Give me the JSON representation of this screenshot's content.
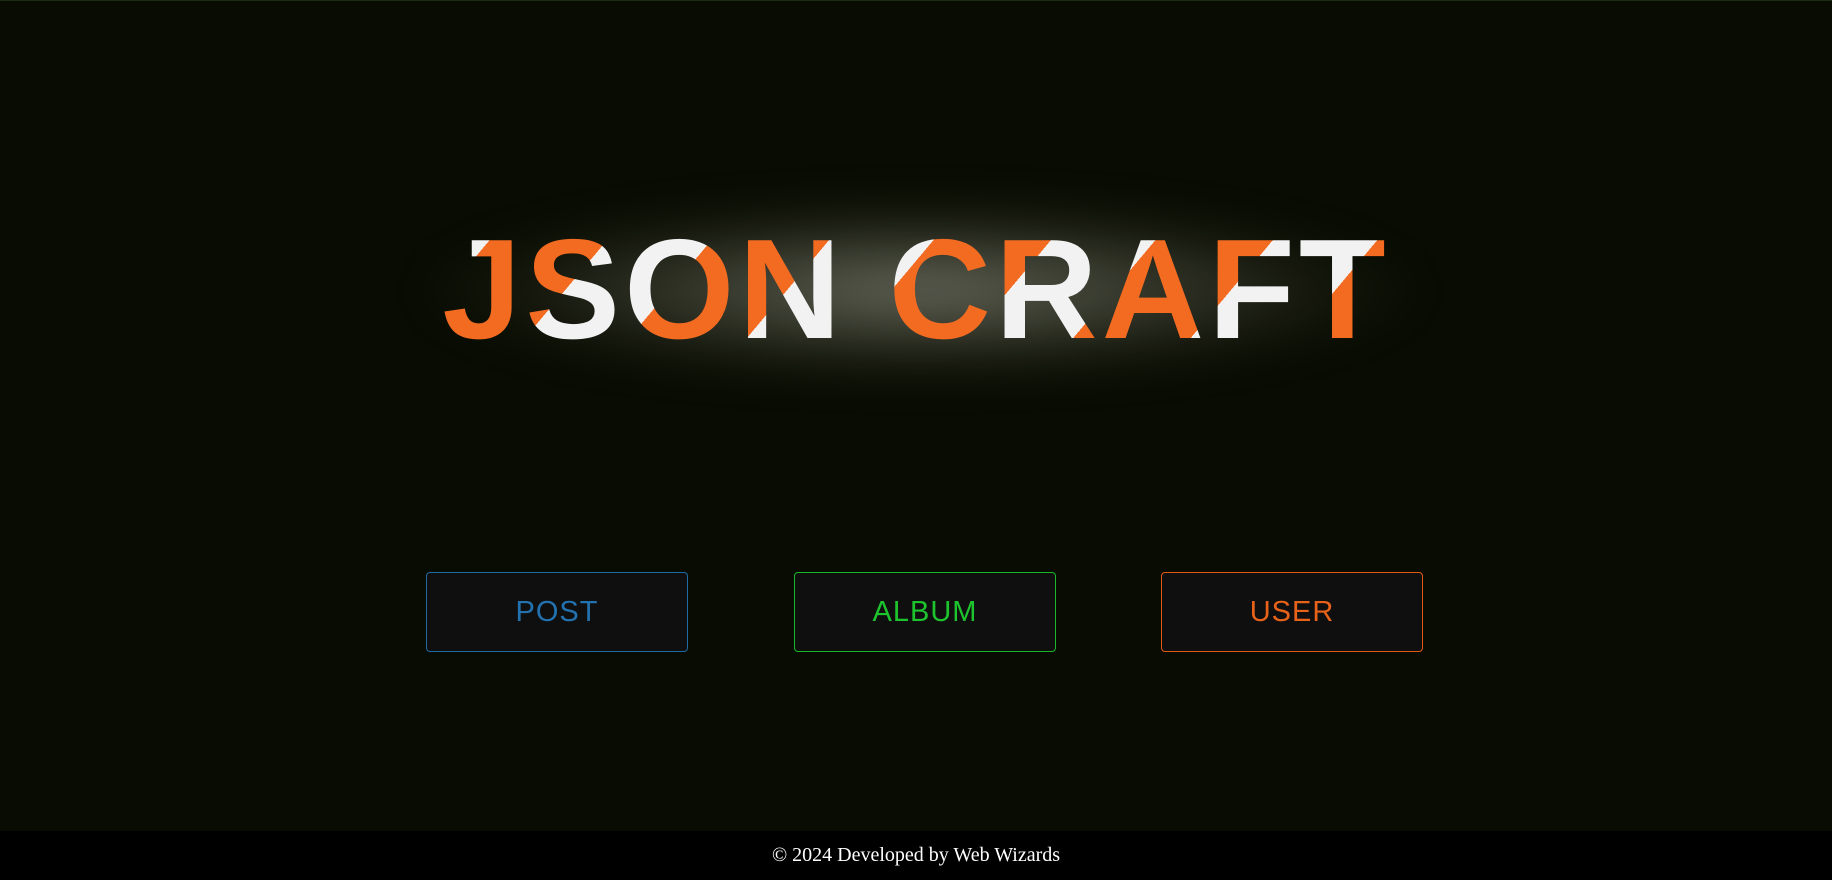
{
  "hero": {
    "title": "JSON CRAFT"
  },
  "colors": {
    "background": "#090c02",
    "accent_orange": "#f26b21",
    "logo_white": "#f2f2f2",
    "post_blue": "#2372b0",
    "album_green": "#1ec42e",
    "user_orange": "#e9621a",
    "footer_bg": "#000000"
  },
  "nav": {
    "post_label": "POST",
    "album_label": "ALBUM",
    "user_label": "USER"
  },
  "footer": {
    "text": "© 2024 Developed by Web Wizards"
  }
}
